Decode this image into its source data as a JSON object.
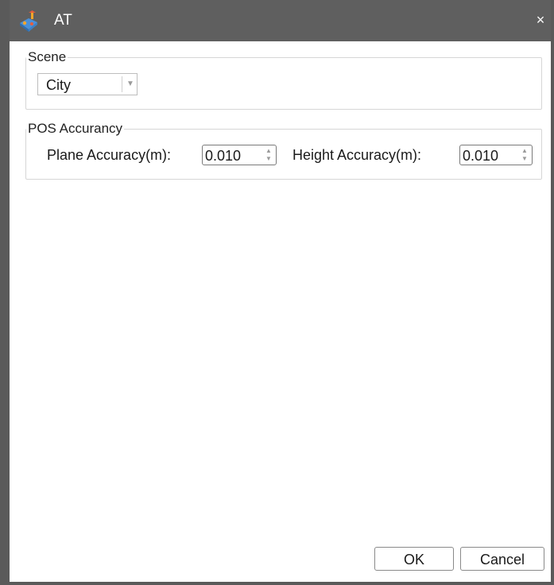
{
  "window": {
    "title": "AT",
    "close_glyph": "×",
    "icon": "app-icon"
  },
  "scene": {
    "legend": "Scene",
    "selected": "City",
    "arrow_glyph": "▼"
  },
  "pos": {
    "legend": "POS Accurancy",
    "plane_label": "Plane Accuracy(m):",
    "plane_value": "0.010",
    "height_label": "Height Accuracy(m):",
    "height_value": "0.010",
    "up_glyph": "▲",
    "down_glyph": "▼"
  },
  "buttons": {
    "ok_label": "OK",
    "cancel_label": "Cancel"
  },
  "colors": {
    "titlebar": "#5f5f5f",
    "frame": "#5a5a5a",
    "background": "#ffffff"
  }
}
